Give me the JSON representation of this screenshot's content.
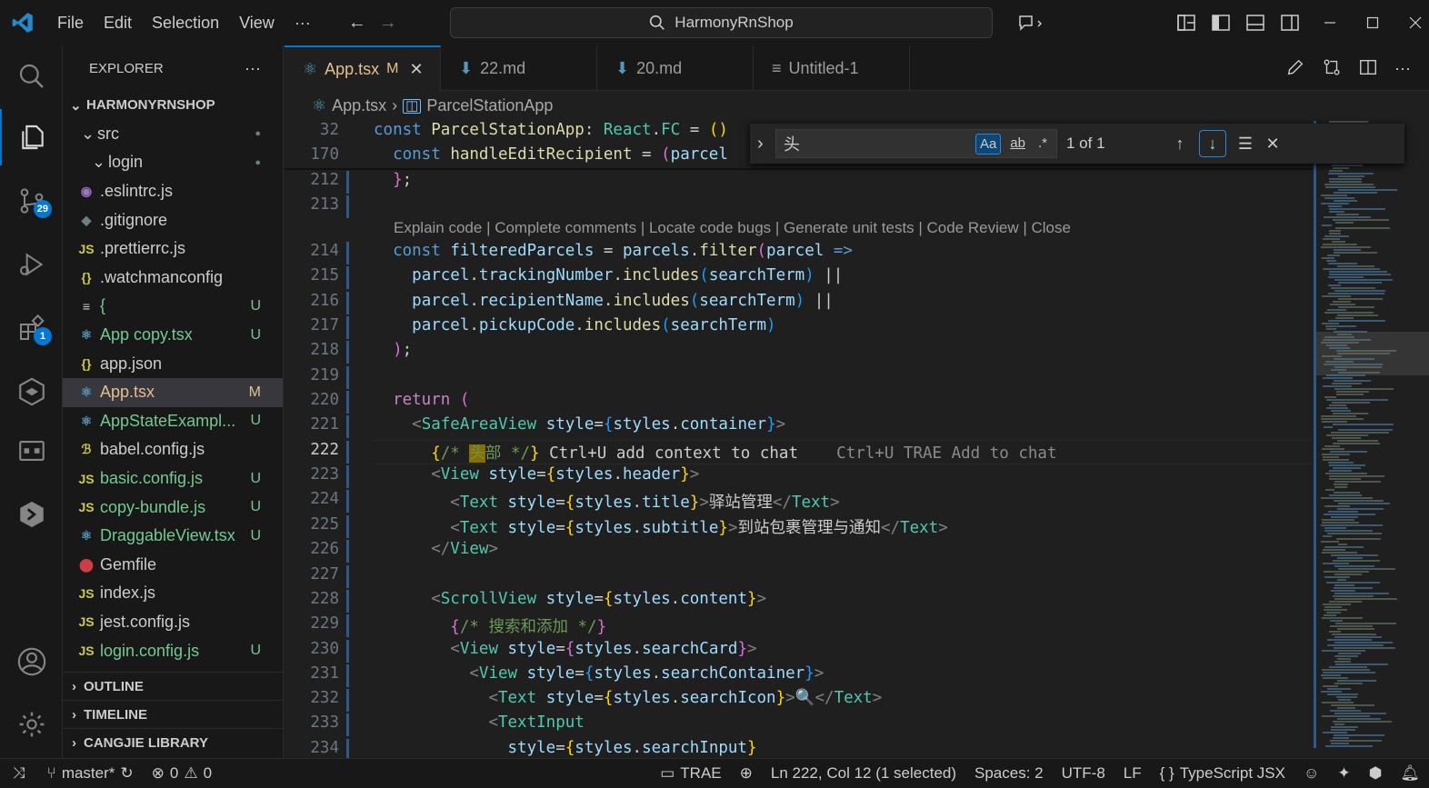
{
  "titlebar": {
    "menu": [
      "File",
      "Edit",
      "Selection",
      "View",
      "···"
    ],
    "search_text": "HarmonyRnShop"
  },
  "activity": {
    "scm_badge": "29",
    "extensions_badge": "1"
  },
  "explorer": {
    "title": "EXPLORER",
    "more": "···",
    "project": "HARMONYRNSHOP",
    "items": [
      {
        "label": "src",
        "icon": "",
        "status": "●",
        "indent": 1,
        "folder": true,
        "cls": ""
      },
      {
        "label": "login",
        "icon": "",
        "status": "●",
        "indent": 2,
        "folder": true,
        "cls": ""
      },
      {
        "label": ".eslintrc.js",
        "icon": "◉",
        "status": "",
        "indent": 0,
        "cls": "",
        "ic": "#a074c4"
      },
      {
        "label": ".gitignore",
        "icon": "◆",
        "status": "",
        "indent": 0,
        "cls": "",
        "ic": "#6d8086"
      },
      {
        "label": ".prettierrc.js",
        "icon": "JS",
        "status": "",
        "indent": 0,
        "cls": "",
        "ic": "#cbcb41"
      },
      {
        "label": ".watchmanconfig",
        "icon": "{}",
        "status": "",
        "indent": 0,
        "cls": "",
        "ic": "#cbcb41"
      },
      {
        "label": "{",
        "icon": "≡",
        "status": "U",
        "indent": 0,
        "cls": "green",
        "ic": "#cccccc"
      },
      {
        "label": "App copy.tsx",
        "icon": "⚛",
        "status": "U",
        "indent": 0,
        "cls": "green",
        "ic": "#519aba"
      },
      {
        "label": "app.json",
        "icon": "{}",
        "status": "",
        "indent": 0,
        "cls": "",
        "ic": "#cbcb41"
      },
      {
        "label": "App.tsx",
        "icon": "⚛",
        "status": "M",
        "indent": 0,
        "cls": "mod",
        "ic": "#519aba",
        "selected": true
      },
      {
        "label": "AppStateExampl...",
        "icon": "⚛",
        "status": "U",
        "indent": 0,
        "cls": "green",
        "ic": "#519aba"
      },
      {
        "label": "babel.config.js",
        "icon": "ℬ",
        "status": "",
        "indent": 0,
        "cls": "",
        "ic": "#cbcb41"
      },
      {
        "label": "basic.config.js",
        "icon": "JS",
        "status": "U",
        "indent": 0,
        "cls": "green",
        "ic": "#cbcb41"
      },
      {
        "label": "copy-bundle.js",
        "icon": "JS",
        "status": "U",
        "indent": 0,
        "cls": "green",
        "ic": "#cbcb41"
      },
      {
        "label": "DraggableView.tsx",
        "icon": "⚛",
        "status": "U",
        "indent": 0,
        "cls": "green",
        "ic": "#519aba"
      },
      {
        "label": "Gemfile",
        "icon": "⬤",
        "status": "",
        "indent": 0,
        "cls": "",
        "ic": "#cc3e44"
      },
      {
        "label": "index.js",
        "icon": "JS",
        "status": "",
        "indent": 0,
        "cls": "",
        "ic": "#cbcb41"
      },
      {
        "label": "jest.config.js",
        "icon": "JS",
        "status": "",
        "indent": 0,
        "cls": "",
        "ic": "#cbcb41"
      },
      {
        "label": "login.config.js",
        "icon": "JS",
        "status": "U",
        "indent": 0,
        "cls": "green",
        "ic": "#cbcb41"
      }
    ],
    "sections": [
      "OUTLINE",
      "TIMELINE",
      "CANGJIE LIBRARY"
    ]
  },
  "tabs": [
    {
      "label": "App.tsx",
      "badge": "M",
      "active": true
    },
    {
      "label": "22.md",
      "badge": ""
    },
    {
      "label": "20.md",
      "badge": ""
    },
    {
      "label": "Untitled-1",
      "badge": ""
    }
  ],
  "breadcrumb": [
    "App.tsx",
    "ParcelStationApp"
  ],
  "find": {
    "query": "头",
    "case_label": "Aa",
    "word_label": "ab",
    "regex_label": ".*",
    "count": "1 of 1"
  },
  "codelens": "Explain code | Complete comments | Locate code bugs | Generate unit tests | Code Review | Close",
  "code": [
    {
      "n": "32",
      "html": "<span class='k'>const</span> <span class='f'>ParcelStationApp</span>: <span class='t'>React</span>.<span class='t'>FC</span> = <span class='p'>()</span>"
    },
    {
      "n": "170",
      "html": "  <span class='k'>const</span> <span class='f'>handleEditRecipient</span> = <span class='p2'>(</span><span class='v'>parcel</span>"
    },
    {
      "n": "212",
      "html": "  <span class='p2'>}</span>;"
    },
    {
      "n": "213",
      "html": ""
    },
    {
      "n": "214",
      "html": "  <span class='k'>const</span> <span class='v'>filteredParcels</span> = <span class='v'>parcels</span>.<span class='f'>filter</span><span class='p2'>(</span><span class='v'>parcel</span> <span class='k'>=&gt;</span>"
    },
    {
      "n": "215",
      "html": "    <span class='v'>parcel</span>.<span class='v'>trackingNumber</span>.<span class='f'>includes</span><span class='p3'>(</span><span class='v'>searchTerm</span><span class='p3'>)</span> ||"
    },
    {
      "n": "216",
      "html": "    <span class='v'>parcel</span>.<span class='v'>recipientName</span>.<span class='f'>includes</span><span class='p3'>(</span><span class='v'>searchTerm</span><span class='p3'>)</span> ||"
    },
    {
      "n": "217",
      "html": "    <span class='v'>parcel</span>.<span class='v'>pickupCode</span>.<span class='f'>includes</span><span class='p3'>(</span><span class='v'>searchTerm</span><span class='p3'>)</span>"
    },
    {
      "n": "218",
      "html": "  <span class='p2'>)</span>;"
    },
    {
      "n": "219",
      "html": ""
    },
    {
      "n": "220",
      "html": "  <span class='kc'>return</span> <span class='p2'>(</span>"
    },
    {
      "n": "221",
      "html": "    <span class='tg'>&lt;</span><span class='t'>SafeAreaView</span> <span class='v'>style</span>=<span class='p3'>{</span><span class='v'>styles</span>.<span class='v'>container</span><span class='p3'>}</span><span class='tg'>&gt;</span>"
    },
    {
      "n": "222",
      "html": "      <span class='p'>{</span><span class='cm'>/* <span style='background:#8a6d00;color:#6a9955'>头</span>部 */</span><span class='p'>}</span> Ctrl+U add context to chat    <span class='gh'>Ctrl+U TRAE Add to chat</span>",
      "cur": true
    },
    {
      "n": "223",
      "html": "      <span class='tg'>&lt;</span><span class='t'>View</span> <span class='v'>style</span>=<span class='p'>{</span><span class='v'>styles</span>.<span class='v'>header</span><span class='p'>}</span><span class='tg'>&gt;</span>"
    },
    {
      "n": "224",
      "html": "        <span class='tg'>&lt;</span><span class='t'>Text</span> <span class='v'>style</span>=<span class='p'>{</span><span class='v'>styles</span>.<span class='v'>title</span><span class='p'>}</span><span class='tg'>&gt;</span>驿站管理<span class='tg'>&lt;/</span><span class='t'>Text</span><span class='tg'>&gt;</span>"
    },
    {
      "n": "225",
      "html": "        <span class='tg'>&lt;</span><span class='t'>Text</span> <span class='v'>style</span>=<span class='p'>{</span><span class='v'>styles</span>.<span class='v'>subtitle</span><span class='p'>}</span><span class='tg'>&gt;</span>到站包裹管理与通知<span class='tg'>&lt;/</span><span class='t'>Text</span><span class='tg'>&gt;</span>"
    },
    {
      "n": "226",
      "html": "      <span class='tg'>&lt;/</span><span class='t'>View</span><span class='tg'>&gt;</span>"
    },
    {
      "n": "227",
      "html": ""
    },
    {
      "n": "228",
      "html": "      <span class='tg'>&lt;</span><span class='t'>ScrollView</span> <span class='v'>style</span>=<span class='p'>{</span><span class='v'>styles</span>.<span class='v'>content</span><span class='p'>}</span><span class='tg'>&gt;</span>"
    },
    {
      "n": "229",
      "html": "        <span class='p2'>{</span><span class='cm'>/* 搜索和添加 */</span><span class='p2'>}</span>"
    },
    {
      "n": "230",
      "html": "        <span class='tg'>&lt;</span><span class='t'>View</span> <span class='v'>style</span>=<span class='p2'>{</span><span class='v'>styles</span>.<span class='v'>searchCard</span><span class='p2'>}</span><span class='tg'>&gt;</span>"
    },
    {
      "n": "231",
      "html": "          <span class='tg'>&lt;</span><span class='t'>View</span> <span class='v'>style</span>=<span class='p3'>{</span><span class='v'>styles</span>.<span class='v'>searchContainer</span><span class='p3'>}</span><span class='tg'>&gt;</span>"
    },
    {
      "n": "232",
      "html": "            <span class='tg'>&lt;</span><span class='t'>Text</span> <span class='v'>style</span>=<span class='p'>{</span><span class='v'>styles</span>.<span class='v'>searchIcon</span><span class='p'>}</span><span class='tg'>&gt;</span>🔍<span class='tg'>&lt;/</span><span class='t'>Text</span><span class='tg'>&gt;</span>"
    },
    {
      "n": "233",
      "html": "            <span class='tg'>&lt;</span><span class='t'>TextInput</span>"
    },
    {
      "n": "234",
      "html": "              <span class='v'>style</span>=<span class='p'>{</span><span class='v'>styles</span>.<span class='v'>searchInput</span><span class='p'>}</span>"
    }
  ],
  "status": {
    "branch": "master*",
    "errors": "0",
    "warnings": "0",
    "trae": "TRAE",
    "position": "Ln 222, Col 12 (1 selected)",
    "spaces": "Spaces: 2",
    "encoding": "UTF-8",
    "eol": "LF",
    "language": "TypeScript JSX"
  },
  "colors": {
    "accent": "#0078d4",
    "modified": "#e2c08d",
    "untracked": "#73c991"
  }
}
